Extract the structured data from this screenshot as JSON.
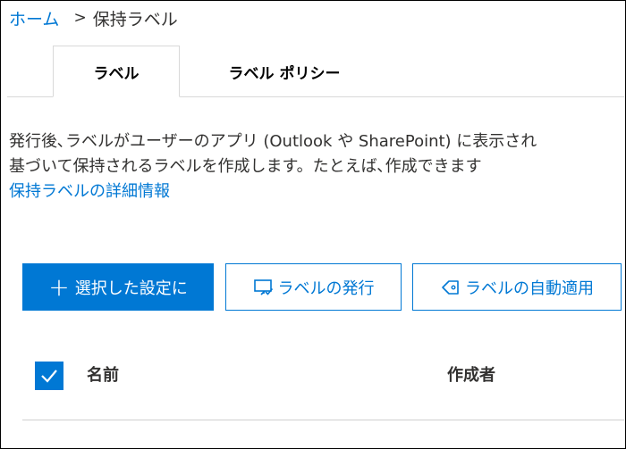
{
  "breadcrumb": {
    "home": "ホーム",
    "separator": ">",
    "current": "保持ラベル"
  },
  "tabs": [
    {
      "label": "ラベル",
      "selected": true
    },
    {
      "label": "ラベル ポリシー",
      "selected": false
    }
  ],
  "description": {
    "line1": "発行後､ラベルがユーザーのアプリ (Outlook や SharePoint) に表示され",
    "line2": "基づいて保持されるラベルを作成します。たとえば､作成できます",
    "more_link": "保持ラベルの詳細情報"
  },
  "commands": {
    "create": "選択した設定に",
    "publish": "ラベルの発行",
    "auto_apply": "ラベルの自動適用"
  },
  "table": {
    "columns": [
      "名前",
      "作成者"
    ],
    "select_all_checked": true
  },
  "colors": {
    "accent": "#0078d4",
    "text": "#323130",
    "divider": "#d9d9d9"
  },
  "icons": {
    "create": "plus-icon",
    "publish": "publish-label-icon",
    "auto_apply": "tag-icon",
    "select_all": "checkmark-icon"
  }
}
